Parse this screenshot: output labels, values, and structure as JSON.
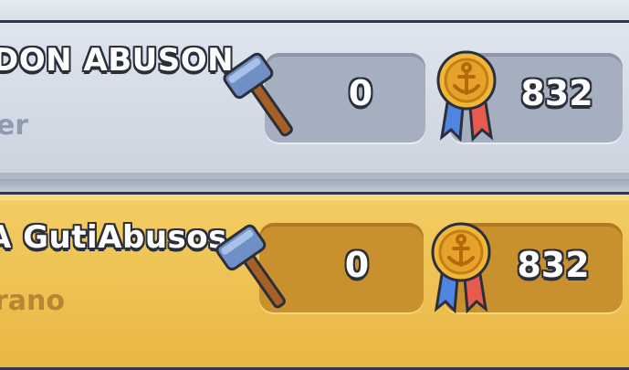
{
  "rows": [
    {
      "player_name": "DON ABUSON",
      "role": "er",
      "donations_icon": "hammer-icon",
      "donations": "0",
      "medal_icon": "anchor-medal-icon",
      "trophies": "832"
    },
    {
      "player_name": "A GutiAbusos",
      "role": "rano",
      "donations_icon": "hammer-icon",
      "donations": "0",
      "medal_icon": "anchor-medal-icon",
      "trophies": "832"
    }
  ],
  "colors": {
    "row_blue": "#d6dce6",
    "row_gold": "#f0c556",
    "role_blue_text": "#8f9bb0",
    "role_gold_text": "#b78631"
  }
}
